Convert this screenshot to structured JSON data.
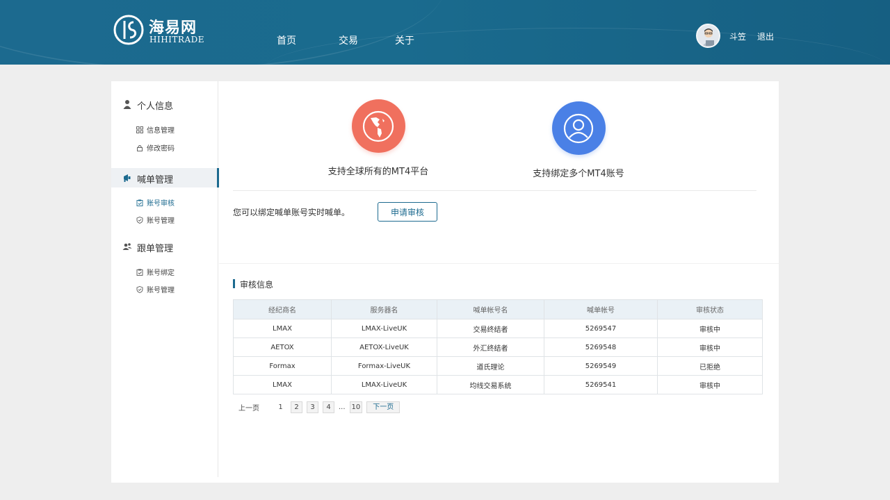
{
  "brand": {
    "name_cn": "海易网",
    "name_en": "HIHITRADE",
    "color": "#1c6a8f"
  },
  "nav": {
    "items": [
      {
        "label": "首页"
      },
      {
        "label": "交易"
      },
      {
        "label": "关于"
      }
    ]
  },
  "user": {
    "name": "斗笠",
    "logout_label": "退出"
  },
  "sidebar": {
    "groups": [
      {
        "label": "个人信息",
        "icon": "person-icon",
        "items": [
          {
            "label": "信息管理",
            "icon": "grid-icon"
          },
          {
            "label": "修改密码",
            "icon": "lock-icon"
          }
        ]
      },
      {
        "label": "喊单管理",
        "icon": "megaphone-icon",
        "active": true,
        "items": [
          {
            "label": "账号审核",
            "icon": "clipboard-icon",
            "active": true
          },
          {
            "label": "账号管理",
            "icon": "shield-icon"
          }
        ]
      },
      {
        "label": "跟单管理",
        "icon": "users-icon",
        "items": [
          {
            "label": "账号绑定",
            "icon": "clipboard-icon"
          },
          {
            "label": "账号管理",
            "icon": "shield-icon"
          }
        ]
      }
    ]
  },
  "features": [
    {
      "text": "支持全球所有的MT4平台",
      "icon": "globe-icon",
      "color": "#f0705e"
    },
    {
      "text": "支持绑定多个MT4账号",
      "icon": "user-circle-icon",
      "color": "#4a80e6"
    }
  ],
  "bind": {
    "text": "您可以绑定喊单账号实时喊单。",
    "button_label": "申请审核"
  },
  "review": {
    "title": "审核信息",
    "columns": [
      "经纪商名",
      "服务器名",
      "喊单帐号名",
      "喊单帐号",
      "审核状态"
    ],
    "rows": [
      [
        "LMAX",
        "LMAX-LiveUK",
        "交易终结者",
        "5269547",
        "审核中"
      ],
      [
        "AETOX",
        "AETOX-LiveUK",
        "外汇终结者",
        "5269548",
        "审核中"
      ],
      [
        "Formax",
        "Formax-LiveUK",
        "道氏理论",
        "5269549",
        "已拒绝"
      ],
      [
        "LMAX",
        "LMAX-LiveUK",
        "均线交易系统",
        "5269541",
        "审核中"
      ]
    ]
  },
  "pagination": {
    "prev": "上一页",
    "pages": [
      "1",
      "2",
      "3",
      "4"
    ],
    "ellipsis": "...",
    "last": "10",
    "next": "下一页",
    "current": "1"
  }
}
